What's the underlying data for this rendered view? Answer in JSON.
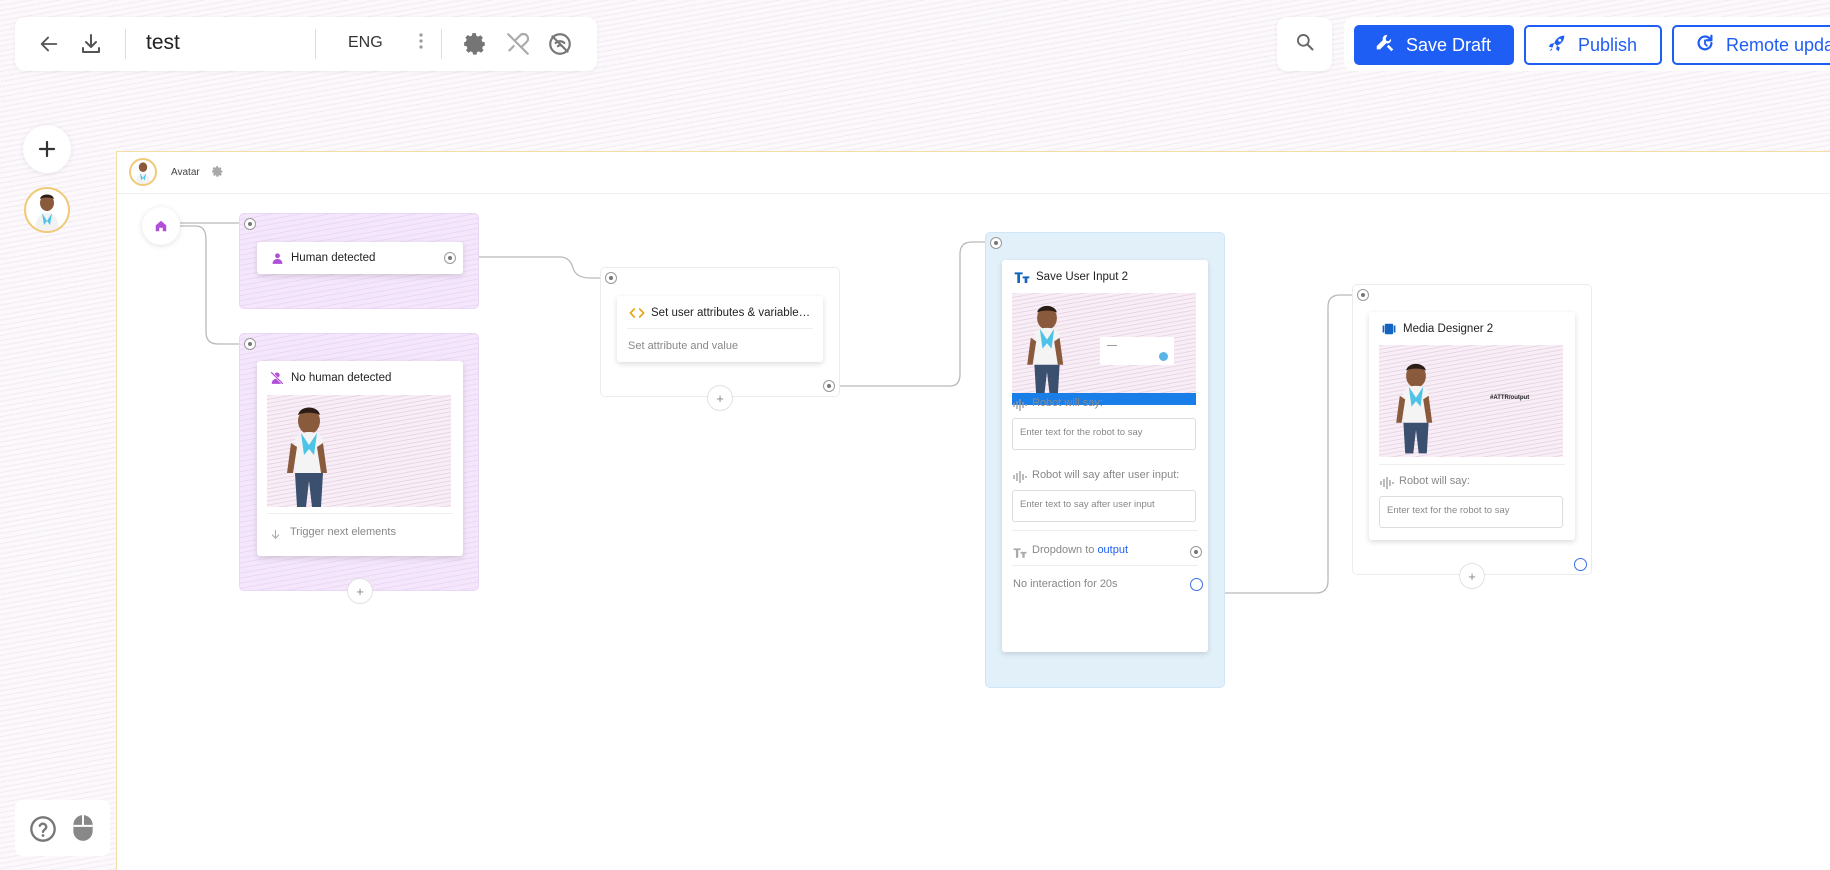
{
  "toolbar": {
    "title": "test",
    "language": "ENG"
  },
  "actions": {
    "save_draft": "Save Draft",
    "publish": "Publish",
    "remote_update": "Remote update"
  },
  "canvas": {
    "header_title": "Avatar"
  },
  "nodes": {
    "human_detected": {
      "title": "Human detected"
    },
    "no_human_detected": {
      "title": "No human detected",
      "trigger": "Trigger next elements"
    },
    "set_attributes": {
      "title": "Set user attributes & variable…",
      "subtitle": "Set attribute and value"
    },
    "save_user_input": {
      "title": "Save User Input 2",
      "robot_will_say": "Robot will say:",
      "robot_placeholder": "Enter text for the robot to say",
      "after_input_label": "Robot will say after user input:",
      "after_input_placeholder": "Enter text to say after user input",
      "dropdown_prefix": "Dropdown to",
      "dropdown_target": "output",
      "no_interaction": "No interaction for 20s"
    },
    "media_designer": {
      "title": "Media Designer 2",
      "preview_text": "#ATTR/output",
      "robot_will_say": "Robot will say:",
      "robot_placeholder": "Enter text for the robot to say"
    }
  },
  "colors": {
    "primary": "#1f5ef5",
    "purple_group": "#f4e6fb",
    "blue_group": "#e2f0fa",
    "node_purple_icon": "#b14fd8",
    "code_icon": "#e8a317",
    "text_icon": "#1565c0"
  },
  "icons": {
    "back": "arrow-left-icon",
    "download": "download-icon",
    "settings": "gear-icon",
    "no_link": "unlink-icon",
    "no_signal": "no-wifi-icon",
    "search": "search-icon",
    "draft": "tools-icon",
    "publish": "rocket-icon",
    "remote": "refresh-icon",
    "help": "help-circle-icon",
    "mouse": "mouse-icon"
  }
}
